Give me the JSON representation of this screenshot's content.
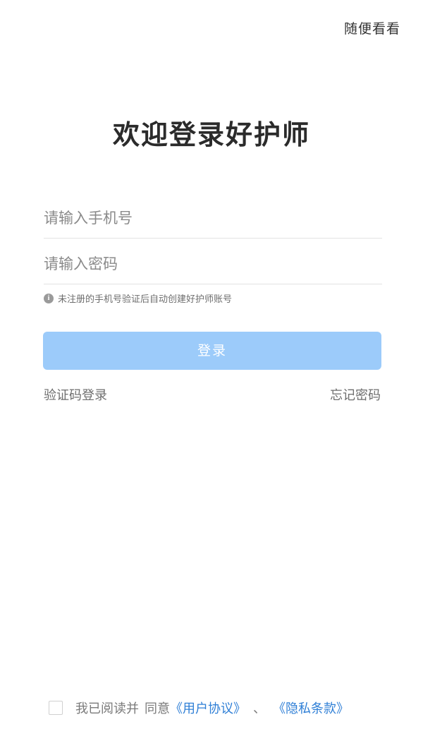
{
  "header": {
    "skip_label": "随便看看"
  },
  "title": "欢迎登录好护师",
  "form": {
    "phone_placeholder": "请输入手机号",
    "password_placeholder": "请输入密码",
    "hint_text": "未注册的手机号验证后自动创建好护师账号",
    "login_button_label": "登录"
  },
  "links": {
    "sms_login": "验证码登录",
    "forgot_password": "忘记密码"
  },
  "agreement": {
    "checked": false,
    "prefix_1": "我已阅读并",
    "prefix_2": "同意",
    "user_agreement": "《用户协议》",
    "separator": "、",
    "privacy_policy": "《隐私条款》"
  },
  "colors": {
    "login_button_bg": "#9ccbfa",
    "link_color": "#2f7fd6"
  },
  "icons": {
    "hint_icon": "info-icon"
  }
}
